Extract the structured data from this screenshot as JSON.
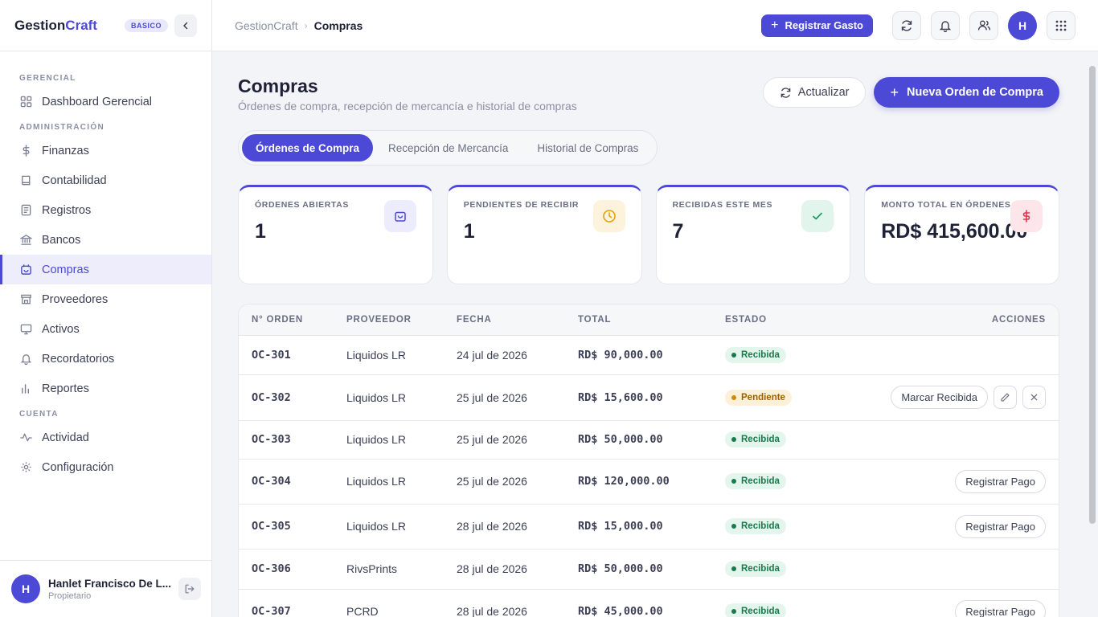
{
  "app": {
    "brand_part1": "Gestion",
    "brand_part2": "Craft",
    "plan": "BASICO"
  },
  "sidebar": {
    "sections": [
      {
        "title": "GERENCIAL",
        "items": [
          {
            "label": "Dashboard Gerencial",
            "icon": "grid-icon"
          }
        ]
      },
      {
        "title": "ADMINISTRACIÓN",
        "items": [
          {
            "label": "Finanzas",
            "icon": "dollar-icon"
          },
          {
            "label": "Contabilidad",
            "icon": "book-icon"
          },
          {
            "label": "Registros",
            "icon": "document-icon"
          },
          {
            "label": "Bancos",
            "icon": "bank-icon"
          },
          {
            "label": "Compras",
            "icon": "basket-icon",
            "active": true
          },
          {
            "label": "Proveedores",
            "icon": "store-icon"
          },
          {
            "label": "Activos",
            "icon": "monitor-icon"
          },
          {
            "label": "Recordatorios",
            "icon": "bell-icon"
          },
          {
            "label": "Reportes",
            "icon": "bar-chart-icon"
          }
        ]
      },
      {
        "title": "CUENTA",
        "items": [
          {
            "label": "Actividad",
            "icon": "activity-icon"
          },
          {
            "label": "Configuración",
            "icon": "gear-icon"
          }
        ]
      }
    ],
    "user": {
      "initial": "H",
      "name": "Hanlet Francisco De L...",
      "role": "Propietario"
    }
  },
  "topbar": {
    "breadcrumb_root": "GestionCraft",
    "breadcrumb_sep": "›",
    "breadcrumb_current": "Compras",
    "register_expense": "Registrar Gasto",
    "avatar_initial": "H"
  },
  "page": {
    "title": "Compras",
    "subtitle": "Órdenes de compra, recepción de mercancía e historial de compras",
    "refresh_label": "Actualizar",
    "new_order_label": "Nueva Orden de Compra",
    "tabs": [
      {
        "label": "Órdenes de Compra",
        "active": true
      },
      {
        "label": "Recepción de Mercancía"
      },
      {
        "label": "Historial de Compras"
      }
    ]
  },
  "stats": [
    {
      "label": "ÓRDENES ABIERTAS",
      "value": "1",
      "icon": "basket-icon",
      "color": "#4b49d6",
      "bg": "#ececfc"
    },
    {
      "label": "PENDIENTES DE RECIBIR",
      "value": "1",
      "icon": "clock-icon",
      "color": "#e5a00d",
      "bg": "#fdf3dc"
    },
    {
      "label": "RECIBIDAS ESTE MES",
      "value": "7",
      "icon": "check-icon",
      "color": "#1a9a5c",
      "bg": "#e2f5ec"
    },
    {
      "label": "MONTO TOTAL EN ÓRDENES",
      "value": "RD$ 415,600.00",
      "icon": "dollar-icon",
      "color": "#e0344f",
      "bg": "#fde6ea"
    }
  ],
  "table": {
    "headers": {
      "order": "N° ORDEN",
      "supplier": "PROVEEDOR",
      "date": "FECHA",
      "total": "TOTAL",
      "status": "ESTADO",
      "actions": "ACCIONES"
    },
    "rows": [
      {
        "order": "OC-301",
        "supplier": "Liquidos LR",
        "date": "24 jul de 2026",
        "total": "RD$ 90,000.00",
        "status": "Recibida",
        "status_type": "ok",
        "actions": []
      },
      {
        "order": "OC-302",
        "supplier": "Liquidos LR",
        "date": "25 jul de 2026",
        "total": "RD$ 15,600.00",
        "status": "Pendiente",
        "status_type": "pend",
        "actions": [
          "Marcar Recibida"
        ],
        "edit": true
      },
      {
        "order": "OC-303",
        "supplier": "Liquidos LR",
        "date": "25 jul de 2026",
        "total": "RD$ 50,000.00",
        "status": "Recibida",
        "status_type": "ok",
        "actions": []
      },
      {
        "order": "OC-304",
        "supplier": "Liquidos LR",
        "date": "25 jul de 2026",
        "total": "RD$ 120,000.00",
        "status": "Recibida",
        "status_type": "ok",
        "actions": [
          "Registrar Pago"
        ]
      },
      {
        "order": "OC-305",
        "supplier": "Liquidos LR",
        "date": "28 jul de 2026",
        "total": "RD$ 15,000.00",
        "status": "Recibida",
        "status_type": "ok",
        "actions": [
          "Registrar Pago"
        ]
      },
      {
        "order": "OC-306",
        "supplier": "RivsPrints",
        "date": "28 jul de 2026",
        "total": "RD$ 50,000.00",
        "status": "Recibida",
        "status_type": "ok",
        "actions": []
      },
      {
        "order": "OC-307",
        "supplier": "PCRD",
        "date": "28 jul de 2026",
        "total": "RD$ 45,000.00",
        "status": "Recibida",
        "status_type": "ok",
        "actions": [
          "Registrar Pago"
        ]
      }
    ]
  }
}
